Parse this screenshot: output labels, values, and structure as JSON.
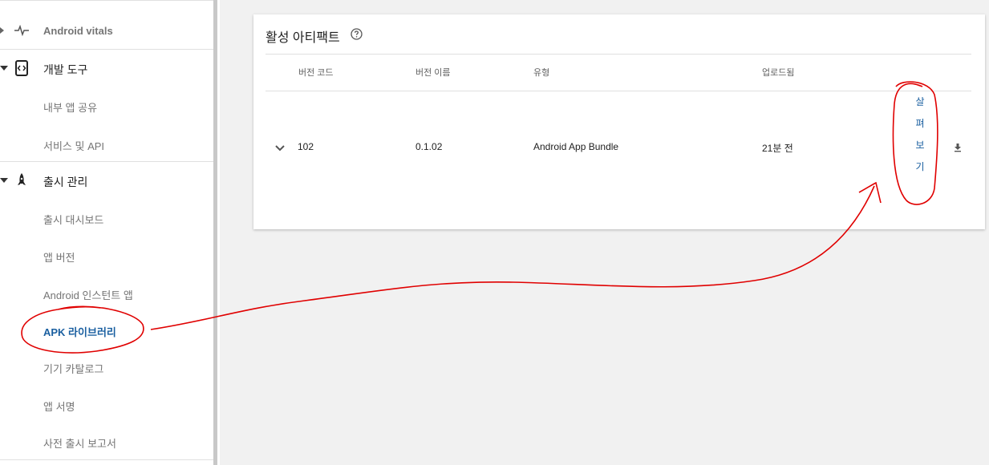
{
  "sidebar": {
    "vitals": {
      "label": "Android vitals",
      "icon": "pulse-icon"
    },
    "dev_tools": {
      "label": "개발 도구",
      "icon": "code-icon",
      "items": [
        {
          "label": "내부 앱 공유"
        },
        {
          "label": "서비스 및 API"
        }
      ]
    },
    "release": {
      "label": "출시 관리",
      "icon": "rocket-icon",
      "items": [
        {
          "label": "출시 대시보드"
        },
        {
          "label": "앱 버전"
        },
        {
          "label": "Android 인스턴트 앱"
        },
        {
          "label": "APK 라이브러리",
          "active": true
        },
        {
          "label": "기기 카탈로그"
        },
        {
          "label": "앱 서명"
        },
        {
          "label": "사전 출시 보고서"
        }
      ]
    }
  },
  "card": {
    "title": "활성 아티팩트",
    "columns": [
      "버전 코드",
      "버전 이름",
      "유형",
      "업로드됨"
    ],
    "rows": [
      {
        "version_code": "102",
        "version_name": "0.1.02",
        "type": "Android App Bundle",
        "uploaded": "21분 전",
        "action_chars": [
          "살",
          "펴",
          "보",
          "기"
        ]
      }
    ]
  },
  "colors": {
    "accent": "#1a5fa0",
    "annotation": "#e00000",
    "background": "#f1f1f1"
  }
}
